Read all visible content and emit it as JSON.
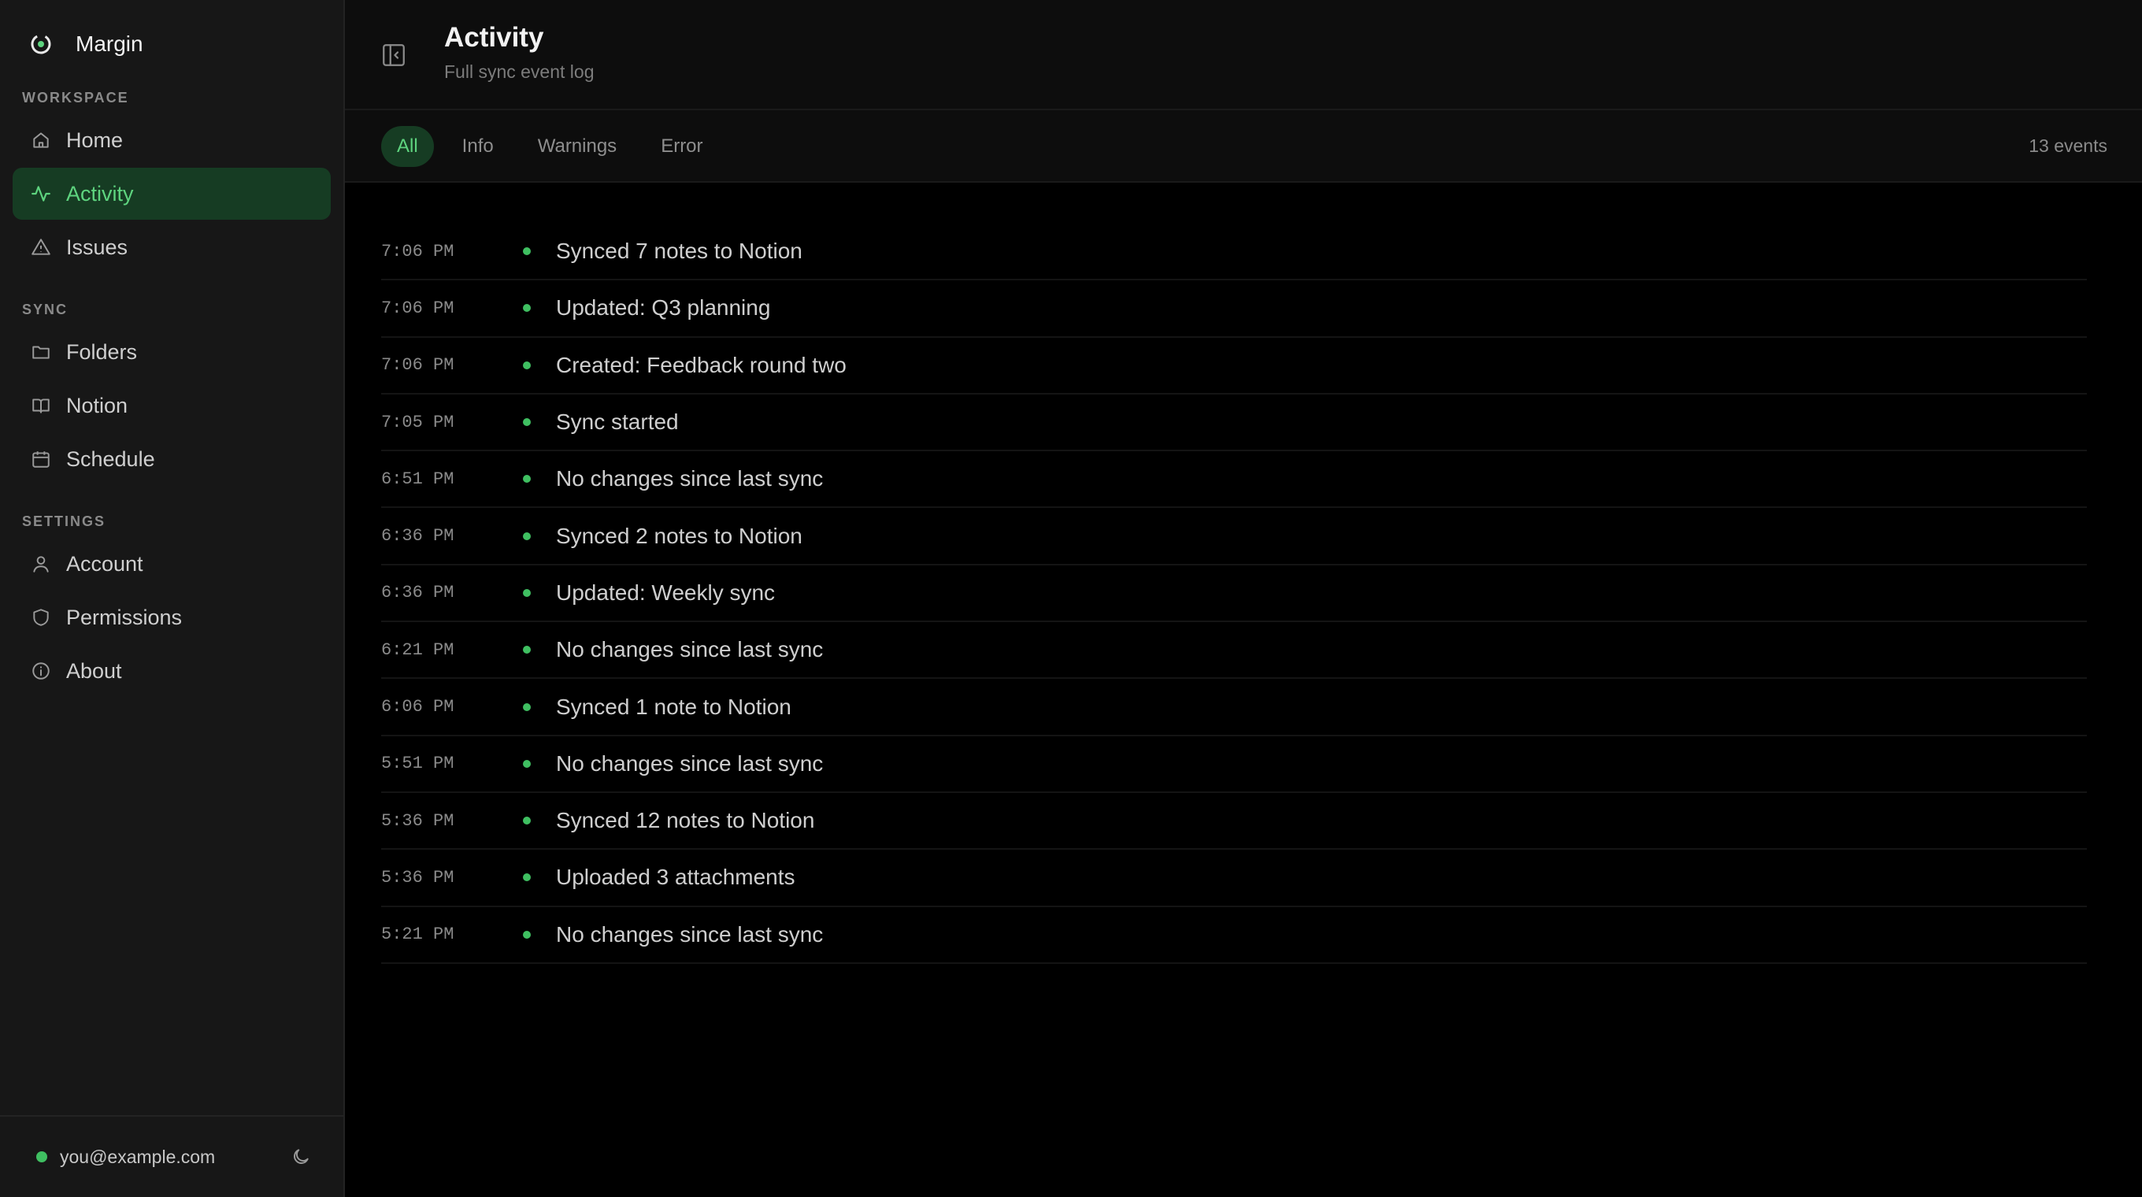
{
  "brand": {
    "name": "Margin"
  },
  "sidebar": {
    "sections": [
      {
        "label": "WORKSPACE",
        "items": [
          {
            "id": "home",
            "label": "Home",
            "icon": "home-icon"
          },
          {
            "id": "activity",
            "label": "Activity",
            "icon": "activity-icon",
            "active": true
          },
          {
            "id": "issues",
            "label": "Issues",
            "icon": "warning-icon"
          }
        ]
      },
      {
        "label": "SYNC",
        "items": [
          {
            "id": "folders",
            "label": "Folders",
            "icon": "folder-icon"
          },
          {
            "id": "notion",
            "label": "Notion",
            "icon": "book-icon"
          },
          {
            "id": "schedule",
            "label": "Schedule",
            "icon": "calendar-icon"
          }
        ]
      },
      {
        "label": "SETTINGS",
        "items": [
          {
            "id": "account",
            "label": "Account",
            "icon": "user-icon"
          },
          {
            "id": "permissions",
            "label": "Permissions",
            "icon": "shield-icon"
          },
          {
            "id": "about",
            "label": "About",
            "icon": "info-icon"
          }
        ]
      }
    ],
    "footer": {
      "email": "you@example.com",
      "status_color": "#3fbf61"
    }
  },
  "header": {
    "title": "Activity",
    "subtitle": "Full sync event log"
  },
  "filters": {
    "tabs": [
      {
        "label": "All",
        "active": true
      },
      {
        "label": "Info"
      },
      {
        "label": "Warnings"
      },
      {
        "label": "Error"
      }
    ],
    "count": "13 events"
  },
  "events": [
    {
      "time": "7:06 PM",
      "message": "Synced 7 notes to Notion"
    },
    {
      "time": "7:06 PM",
      "message": "Updated: Q3 planning"
    },
    {
      "time": "7:06 PM",
      "message": "Created: Feedback round two"
    },
    {
      "time": "7:05 PM",
      "message": "Sync started"
    },
    {
      "time": "6:51 PM",
      "message": "No changes since last sync"
    },
    {
      "time": "6:36 PM",
      "message": "Synced 2 notes to Notion"
    },
    {
      "time": "6:36 PM",
      "message": "Updated: Weekly sync"
    },
    {
      "time": "6:21 PM",
      "message": "No changes since last sync"
    },
    {
      "time": "6:06 PM",
      "message": "Synced 1 note to Notion"
    },
    {
      "time": "5:51 PM",
      "message": "No changes since last sync"
    },
    {
      "time": "5:36 PM",
      "message": "Synced 12 notes to Notion"
    },
    {
      "time": "5:36 PM",
      "message": "Uploaded 3 attachments"
    },
    {
      "time": "5:21 PM",
      "message": "No changes since last sync"
    }
  ],
  "colors": {
    "accent": "#5ed47f",
    "accent_bg": "#163c23",
    "event_dot": "#3fbf61"
  }
}
